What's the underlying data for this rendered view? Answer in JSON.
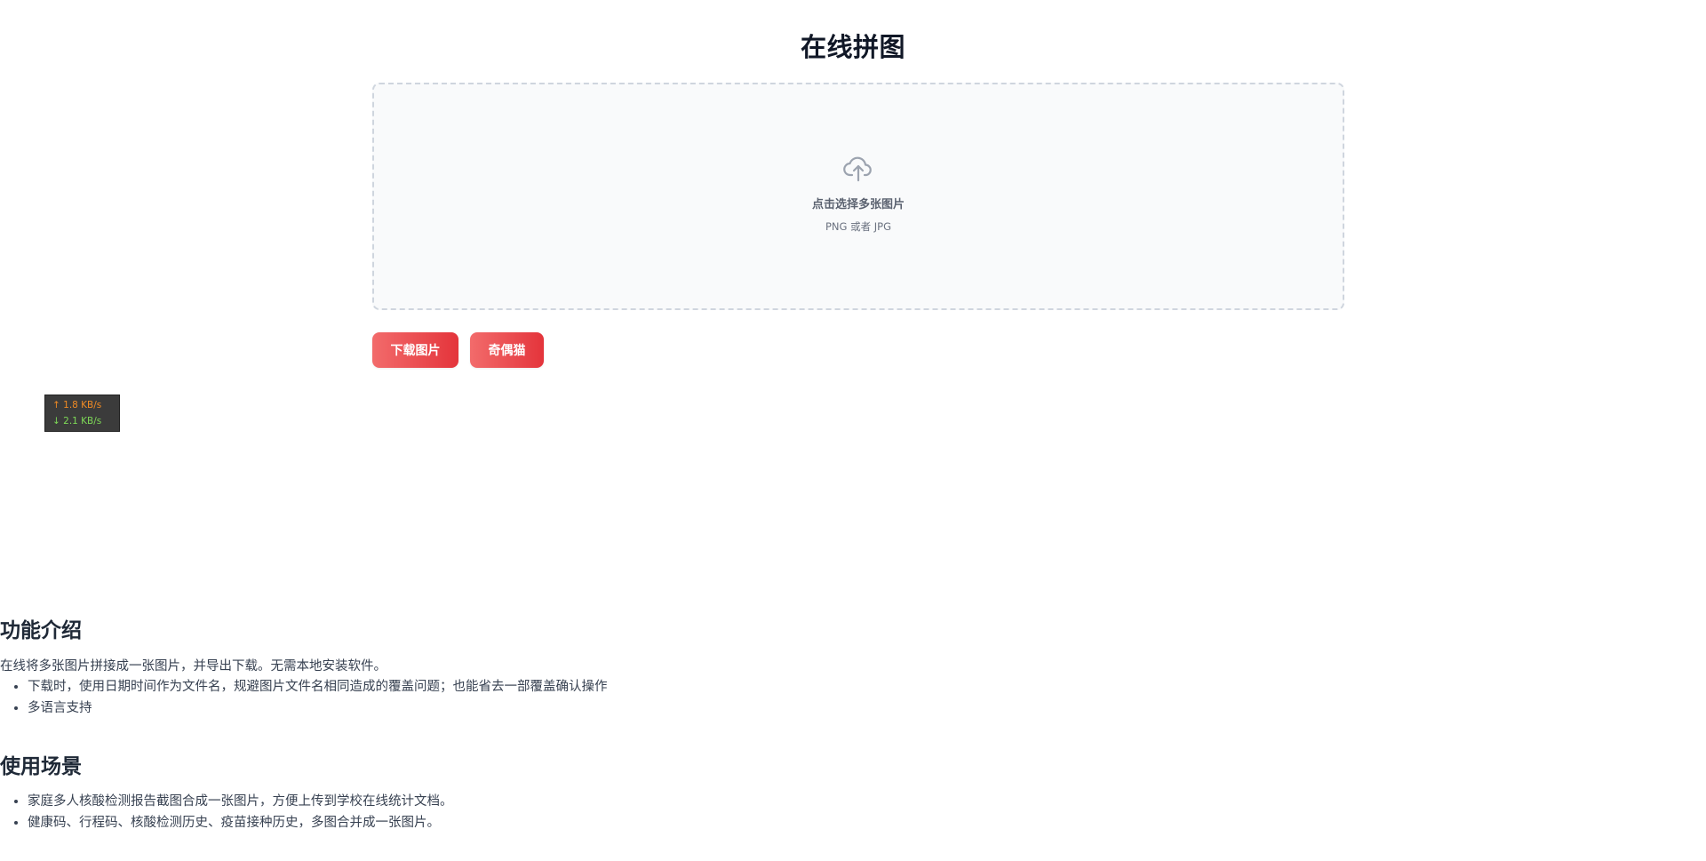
{
  "page": {
    "title": "在线拼图"
  },
  "upload": {
    "icon": "cloud-upload-icon",
    "title": "点击选择多张图片",
    "subtitle": "PNG 或者 JPG"
  },
  "buttons": {
    "download_label": "下载图片",
    "cat_label": "奇偶猫"
  },
  "speed_widget": {
    "upload": "↑ 1.8 KB/s",
    "download": "↓ 2.1 KB/s"
  },
  "features": {
    "heading": "功能介绍",
    "intro": "在线将多张图片拼接成一张图片，并导出下载。无需本地安装软件。",
    "items": [
      "下载时，使用日期时间作为文件名，规避图片文件名相同造成的覆盖问题；也能省去一部覆盖确认操作",
      "多语言支持"
    ]
  },
  "usage": {
    "heading": "使用场景",
    "items": [
      "家庭多人核酸检测报告截图合成一张图片，方便上传到学校在线统计文档。",
      "健康码、行程码、核酸检测历史、疫苗接种历史，多图合并成一张图片。"
    ]
  },
  "colors": {
    "button_gradient_start": "#f26b6b",
    "button_gradient_end": "#e4343b",
    "dropzone_border": "#cfd5de",
    "dropzone_bg": "#f9fafb"
  }
}
